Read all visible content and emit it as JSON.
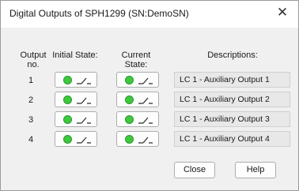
{
  "window": {
    "title": "Digital Outputs of SPH1299 (SN:DemoSN)",
    "close_glyph": "✕"
  },
  "headers": {
    "output_line1": "Output",
    "output_line2": "no.",
    "initial_state": "Initial State:",
    "current_line1": "Current",
    "current_line2": "State:",
    "descriptions": "Descriptions:"
  },
  "rows": [
    {
      "num": "1",
      "description": "LC 1 - Auxiliary Output 1"
    },
    {
      "num": "2",
      "description": "LC 1 - Auxiliary Output 2"
    },
    {
      "num": "3",
      "description": "LC 1 - Auxiliary Output 3"
    },
    {
      "num": "4",
      "description": "LC 1 - Auxiliary Output 4"
    }
  ],
  "state_indicator": {
    "led_color": "#3ec83e",
    "icon": "open-switch-icon"
  },
  "buttons": {
    "close": "Close",
    "help": "Help"
  }
}
